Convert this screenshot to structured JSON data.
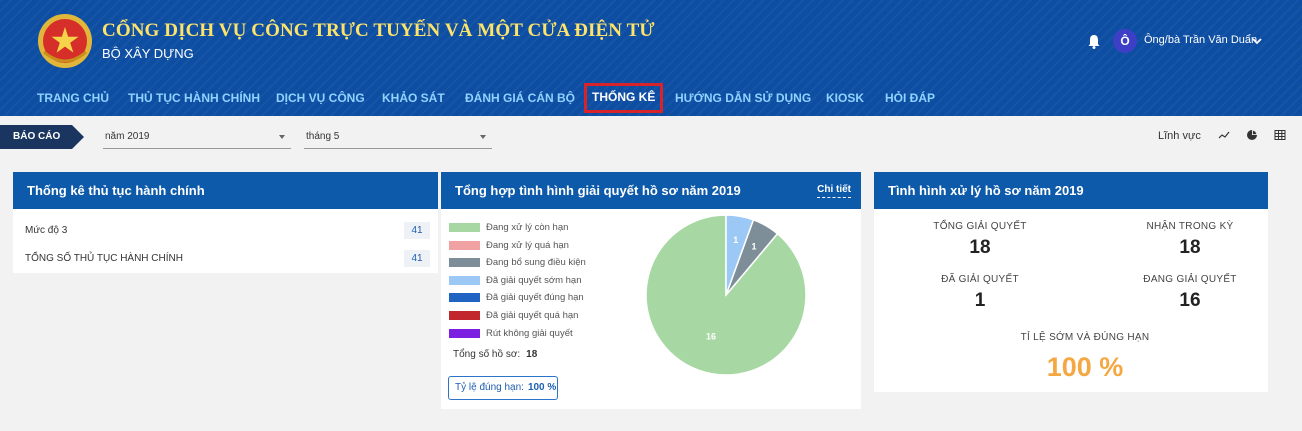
{
  "header": {
    "title": "CỔNG DỊCH VỤ CÔNG TRỰC TUYẾN VÀ MỘT CỬA ĐIỆN TỬ",
    "subtitle": "BỘ XÂY DỰNG",
    "avatar_initial": "Ô",
    "username": "Ông/bà Trần Văn Duẩn",
    "icons": {
      "emblem": "national-emblem",
      "bell": "bell-icon",
      "chevron": "chevron-down-icon"
    }
  },
  "nav": {
    "items": [
      "TRANG CHỦ",
      "THỦ TỤC HÀNH CHÍNH",
      "DỊCH VỤ CÔNG",
      "KHẢO SÁT",
      "ĐÁNH GIÁ CÁN BỘ",
      "THỐNG KÊ",
      "HƯỚNG DẪN SỬ DỤNG",
      "KIOSK",
      "HỎI ĐÁP"
    ],
    "active": "THỐNG KÊ"
  },
  "filters": {
    "label": "BÁO CÁO",
    "year": "năm 2019",
    "month": "tháng 5",
    "field_label": "Lĩnh vực",
    "icons": [
      "line-chart-icon",
      "pie-chart-icon",
      "table-icon"
    ]
  },
  "procedures_panel": {
    "title": "Thống kê thủ tục hành chính",
    "rows": [
      {
        "label": "Mức độ 3",
        "count": "41"
      },
      {
        "label": "TỔNG SỐ THỦ TỤC HÀNH CHÍNH",
        "count": "41"
      }
    ]
  },
  "summary_panel": {
    "title": "Tổng hợp tình hình giải quyết hồ sơ năm 2019",
    "detail_link": "Chi tiết",
    "total_label": "Tổng số hồ sơ:",
    "total_value": "18",
    "rate_label": "Tỷ lệ đúng hạn:",
    "rate_value": "100 %"
  },
  "chart_data": {
    "type": "pie",
    "categories": [
      "Đang xử lý còn hạn",
      "Đang xử lý quá hạn",
      "Đang bổ sung điều kiện",
      "Đã giải quyết sớm hạn",
      "Đã giải quyết đúng hạn",
      "Đã giải quyết quá hạn",
      "Rút không giải quyết"
    ],
    "values": [
      16,
      0,
      1,
      1,
      0,
      0,
      0
    ],
    "colors": [
      "#a7d8a3",
      "#f0a1a1",
      "#7d8e99",
      "#9cc8f5",
      "#2063c2",
      "#c2272d",
      "#7b1fe0"
    ],
    "labels_shown": [
      "16",
      "",
      "1",
      "1",
      "",
      "",
      ""
    ],
    "legend_placement": "left"
  },
  "processing_panel": {
    "title": "Tình hình xử lý hồ sơ năm 2019",
    "stats": [
      {
        "label": "TỔNG GIẢI QUYẾT",
        "value": "18"
      },
      {
        "label": "NHẬN TRONG KỲ",
        "value": "18"
      },
      {
        "label": "ĐÃ GIẢI QUYẾT",
        "value": "1"
      },
      {
        "label": "ĐANG GIẢI QUYẾT",
        "value": "16"
      }
    ],
    "rate_label": "TỈ LỆ SỚM VÀ ĐÚNG HẠN",
    "rate_value": "100 %",
    "accent": "#f5a742"
  }
}
